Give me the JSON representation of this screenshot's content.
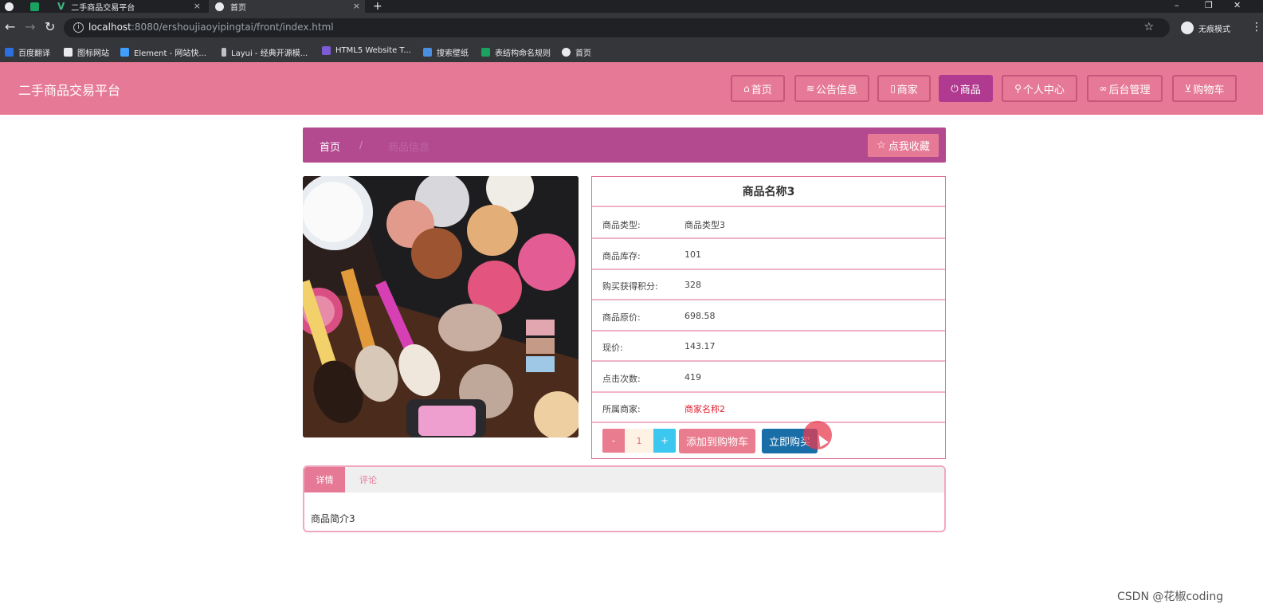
{
  "browser": {
    "tabs": [
      {
        "title": ""
      },
      {
        "title": ""
      },
      {
        "title": "二手商品交易平台"
      },
      {
        "title": "首页"
      }
    ],
    "new_tab": "+",
    "url_host": "localhost",
    "url_rest": ":8080/ershoujiaoyipingtai/front/index.html",
    "incognito_label": "无痕模式",
    "bookmarks": [
      "百度翻译",
      "图标网站",
      "Element - 网站快...",
      "Layui - 经典开源模...",
      "HTML5 Website T...",
      "搜索壁纸",
      "表结构命名规则",
      "首页"
    ]
  },
  "header": {
    "site_title": "二手商品交易平台",
    "nav": [
      {
        "icon": "home-icon",
        "label": "首页"
      },
      {
        "icon": "layers-icon",
        "label": "公告信息"
      },
      {
        "icon": "store-icon",
        "label": "商家"
      },
      {
        "icon": "power-icon",
        "label": "商品"
      },
      {
        "icon": "user-icon",
        "label": "个人中心"
      },
      {
        "icon": "link-icon",
        "label": "后台管理"
      },
      {
        "icon": "cart-icon",
        "label": "购物车"
      }
    ]
  },
  "breadcrumb": {
    "home": "首页",
    "separator": "/",
    "current": "商品信息",
    "favorite_button": "点我收藏"
  },
  "product": {
    "name": "商品名称3",
    "rows": [
      {
        "label": "商品类型:",
        "value": "商品类型3"
      },
      {
        "label": "商品库存:",
        "value": "101"
      },
      {
        "label": "购买获得积分:",
        "value": "328"
      },
      {
        "label": "商品原价:",
        "value": "698.58"
      },
      {
        "label": "现价:",
        "value": "143.17"
      },
      {
        "label": "点击次数:",
        "value": "419"
      },
      {
        "label": "所属商家:",
        "value": "商家名称2"
      }
    ],
    "quantity": "1",
    "minus": "-",
    "plus": "+",
    "add_to_cart": "添加到购物车",
    "buy_now": "立即购买"
  },
  "detail_tabs": {
    "tabs": [
      "详情",
      "评论"
    ],
    "content": "商品简介3"
  },
  "watermark": "CSDN @花椒coding",
  "colors": {
    "header": "#e67a96",
    "crumbbar": "#b34a90",
    "active_nav": "#b03a8f",
    "buy": "#1a6ea8",
    "plus": "#3bc7ef",
    "merchant_link": "#e0202e"
  }
}
